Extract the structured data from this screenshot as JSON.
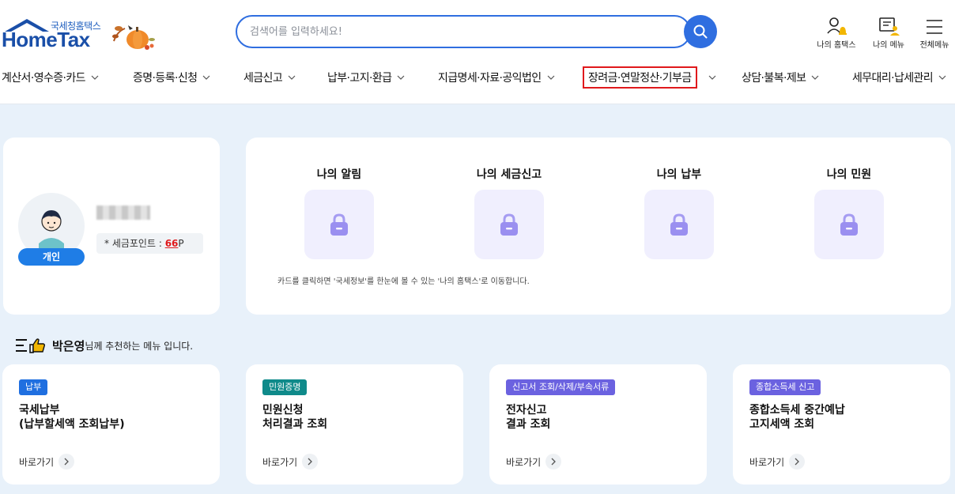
{
  "header": {
    "logo_sub": "국세청홈택스",
    "logo_main": "HomeTax",
    "search_placeholder": "검색어를 입력하세요!",
    "util": [
      {
        "label": "나의 홈택스",
        "icon": "user-bell-icon"
      },
      {
        "label": "나의 메뉴",
        "icon": "menu-user-icon"
      },
      {
        "label": "전체메뉴",
        "icon": "hamburger-icon"
      }
    ]
  },
  "gnb": [
    {
      "label": "계산서·영수증·카드"
    },
    {
      "label": "증명·등록·신청"
    },
    {
      "label": "세금신고"
    },
    {
      "label": "납부·고지·환급"
    },
    {
      "label": "지급명세·자료·공익법인"
    },
    {
      "label": "장려금·연말정산·기부금",
      "highlighted": true
    },
    {
      "label": "상담·불복·제보"
    },
    {
      "label": "세무대리·납세관리"
    }
  ],
  "profile": {
    "type_label": "개인",
    "points_label": "* 세금포인트 : ",
    "points_value": "66",
    "points_unit": "P"
  },
  "my_cards": {
    "items": [
      {
        "title": "나의 알림",
        "icon": "lock-icon"
      },
      {
        "title": "나의 세금신고",
        "icon": "lock-icon"
      },
      {
        "title": "나의 납부",
        "icon": "lock-icon"
      },
      {
        "title": "나의 민원",
        "icon": "lock-icon"
      }
    ],
    "note": "카드를 클릭하면 '국세정보'를 한눈에 볼 수 있는 '나의 홈택스'로 이동합니다."
  },
  "recommend": {
    "name": "박은영",
    "text": "님께 추천하는 메뉴 입니다.",
    "cards": [
      {
        "badge": "납부",
        "badge_color": "#1f6fe0",
        "title_1": "국세납부",
        "title_2": "(납부할세액 조회납부)",
        "go": "바로가기"
      },
      {
        "badge": "민원증명",
        "badge_color": "#0f8a8a",
        "title_1": "민원신청",
        "title_2": "처리결과 조회",
        "go": "바로가기"
      },
      {
        "badge": "신고서 조회/삭제/부속서류",
        "badge_color": "#6b62e0",
        "title_1": "전자신고",
        "title_2": "결과 조회",
        "go": "바로가기"
      },
      {
        "badge": "종합소득세 신고",
        "badge_color": "#6b62e0",
        "title_1": "종합소득세 중간예납",
        "title_2": "고지세액 조회",
        "go": "바로가기"
      }
    ]
  },
  "colors": {
    "accent": "#2f6ee0",
    "highlight_border": "#e0191c",
    "page_bg": "#e8f1fa"
  }
}
